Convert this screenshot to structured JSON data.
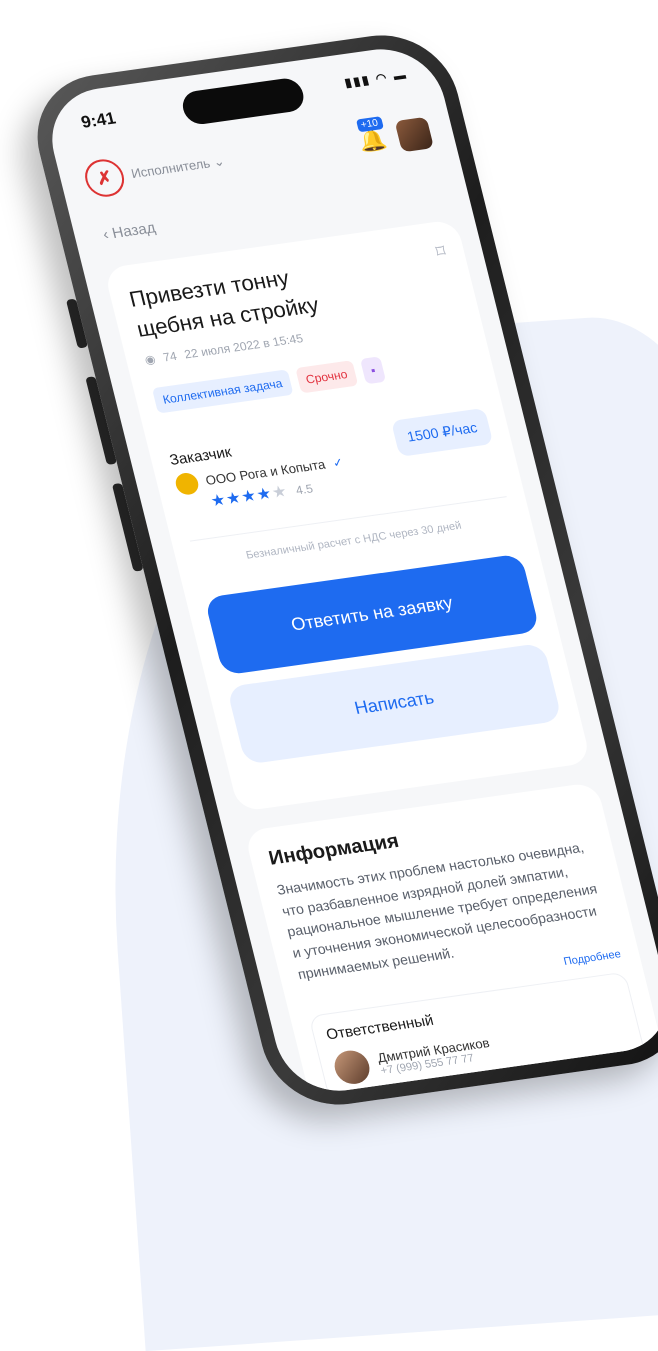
{
  "status_bar": {
    "time": "9:41",
    "icons": "▮▮▮ ◠ ▬"
  },
  "header": {
    "role": "Исполнитель ⌄",
    "logo_glyph": "✗",
    "notifications_badge": "+10",
    "bell_glyph": "🔔"
  },
  "nav": {
    "back": "‹  Назад"
  },
  "task": {
    "title": "Привезти тонну щебня на стройку",
    "views": "74",
    "date": "22 июля 2022 в 15:45",
    "tags": [
      "Коллективная задача",
      "Срочно",
      "▪"
    ],
    "customer_label": "Заказчик",
    "customer_name": "ООО Рога и Копыта",
    "verified": "✓",
    "rating_stars": "★★★★",
    "rating_off": "★",
    "rating": "4.5",
    "price": "1500 ₽/час",
    "payment": "Безналичный расчет с НДС через 30 дней"
  },
  "actions": {
    "respond": "Ответить на заявку",
    "write": "Написать"
  },
  "info": {
    "title": "Информация",
    "text": "Значимость этих проблем настолько очевидна, что разбавленное изрядной долей эмпатии, рациональное мышление требует определения и уточнения экономической целесообразности принимаемых решений.",
    "more": "Подробнее"
  },
  "responsible": {
    "label": "Ответственный",
    "name": "Дмитрий Красиков",
    "phone": "+7 (999) 555 77 77"
  }
}
